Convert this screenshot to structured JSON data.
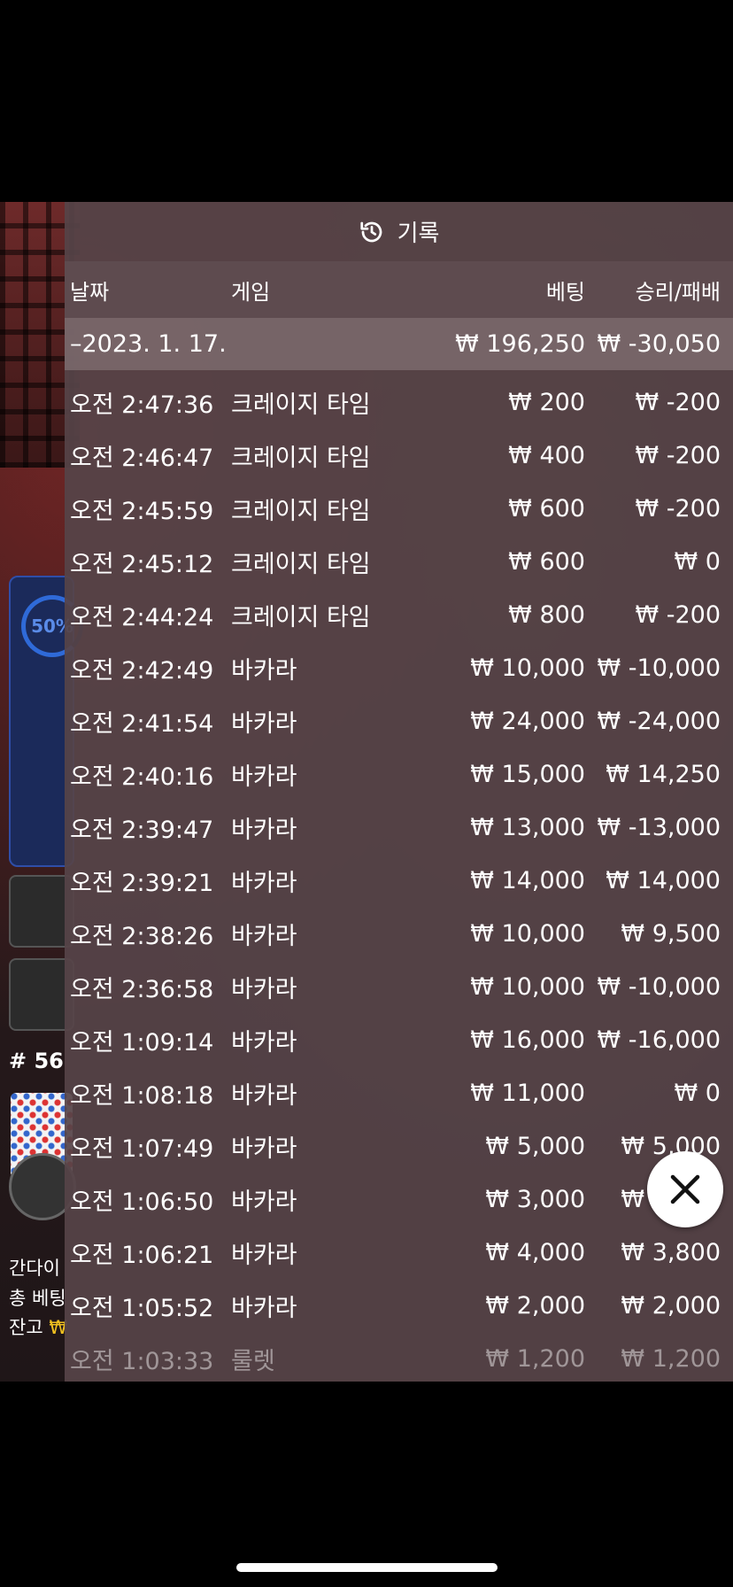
{
  "background": {
    "progress_percent": "50%",
    "round_number": "# 56",
    "line1": "간다이",
    "line2": "총 베팅",
    "line3_label": "잔고",
    "line3_currency": "₩"
  },
  "panel": {
    "title": "기록",
    "columns": {
      "date": "날짜",
      "game": "게임",
      "bet": "베팅",
      "winloss": "승리/패배"
    },
    "date_group": {
      "date": "–2023. 1. 17.",
      "total_bet": "₩ 196,250",
      "total_winloss": "₩ -30,050"
    },
    "rows": [
      {
        "time": "오전 2:47:36",
        "game": "크레이지 타임",
        "bet": "₩ 200",
        "winloss": "₩ -200"
      },
      {
        "time": "오전 2:46:47",
        "game": "크레이지 타임",
        "bet": "₩ 400",
        "winloss": "₩ -200"
      },
      {
        "time": "오전 2:45:59",
        "game": "크레이지 타임",
        "bet": "₩ 600",
        "winloss": "₩ -200"
      },
      {
        "time": "오전 2:45:12",
        "game": "크레이지 타임",
        "bet": "₩ 600",
        "winloss": "₩ 0"
      },
      {
        "time": "오전 2:44:24",
        "game": "크레이지 타임",
        "bet": "₩ 800",
        "winloss": "₩ -200"
      },
      {
        "time": "오전 2:42:49",
        "game": "바카라",
        "bet": "₩ 10,000",
        "winloss": "₩ -10,000"
      },
      {
        "time": "오전 2:41:54",
        "game": "바카라",
        "bet": "₩ 24,000",
        "winloss": "₩ -24,000"
      },
      {
        "time": "오전 2:40:16",
        "game": "바카라",
        "bet": "₩ 15,000",
        "winloss": "₩ 14,250"
      },
      {
        "time": "오전 2:39:47",
        "game": "바카라",
        "bet": "₩ 13,000",
        "winloss": "₩ -13,000"
      },
      {
        "time": "오전 2:39:21",
        "game": "바카라",
        "bet": "₩ 14,000",
        "winloss": "₩ 14,000"
      },
      {
        "time": "오전 2:38:26",
        "game": "바카라",
        "bet": "₩ 10,000",
        "winloss": "₩ 9,500"
      },
      {
        "time": "오전 2:36:58",
        "game": "바카라",
        "bet": "₩ 10,000",
        "winloss": "₩ -10,000"
      },
      {
        "time": "오전 1:09:14",
        "game": "바카라",
        "bet": "₩ 16,000",
        "winloss": "₩ -16,000"
      },
      {
        "time": "오전 1:08:18",
        "game": "바카라",
        "bet": "₩ 11,000",
        "winloss": "₩ 0"
      },
      {
        "time": "오전 1:07:49",
        "game": "바카라",
        "bet": "₩ 5,000",
        "winloss": "₩ 5,000"
      },
      {
        "time": "오전 1:06:50",
        "game": "바카라",
        "bet": "₩ 3,000",
        "winloss": "₩ 2,850"
      },
      {
        "time": "오전 1:06:21",
        "game": "바카라",
        "bet": "₩ 4,000",
        "winloss": "₩ 3,800"
      },
      {
        "time": "오전 1:05:52",
        "game": "바카라",
        "bet": "₩ 2,000",
        "winloss": "₩ 2,000"
      },
      {
        "time": "오전 1:03:33",
        "game": "룰렛",
        "bet": "₩ 1,200",
        "winloss": "₩ 1,200"
      }
    ]
  },
  "icons": {
    "header_icon": "history-icon",
    "close_icon": "close-icon"
  }
}
